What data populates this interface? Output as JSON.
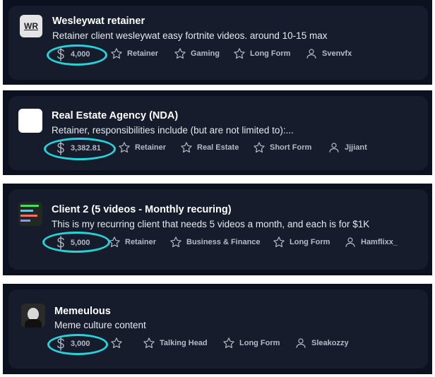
{
  "cards": [
    {
      "thumb_text": "WR",
      "title": "Wesleywat retainer",
      "desc": "Retainer client wesleywat easy fortnite videos. around 10-15 max",
      "price": "4,000",
      "tag1": "Retainer",
      "tag2": "Gaming",
      "tag3": "Long Form",
      "user": "Svenvfx"
    },
    {
      "thumb_text": "",
      "title": "Real Estate Agency (NDA)",
      "desc": "Retainer, responsibilities include (but are not limited to):...",
      "price": "3,382.81",
      "tag1": "Retainer",
      "tag2": "Real Estate",
      "tag3": "Short Form",
      "user": "Jjjiant"
    },
    {
      "thumb_text": "",
      "title": "Client 2 (5 videos - Monthly recuring)",
      "desc": "This is my recurring client that needs 5 videos a month, and each is for $1K",
      "price": "5,000",
      "tag1": "Retainer",
      "tag2": "Business & Finance",
      "tag3": "Long Form",
      "user": "Hamflixx_"
    },
    {
      "thumb_text": "",
      "title": "Memeulous",
      "desc": "Meme culture content",
      "price": "3,000",
      "tag1": "",
      "tag2": "Talking Head",
      "tag3": "Long Form",
      "user": "Sleakozzy"
    }
  ],
  "colors": {
    "highlight": "#27d3da",
    "card": "#161c2b",
    "frame": "#0c1120"
  }
}
